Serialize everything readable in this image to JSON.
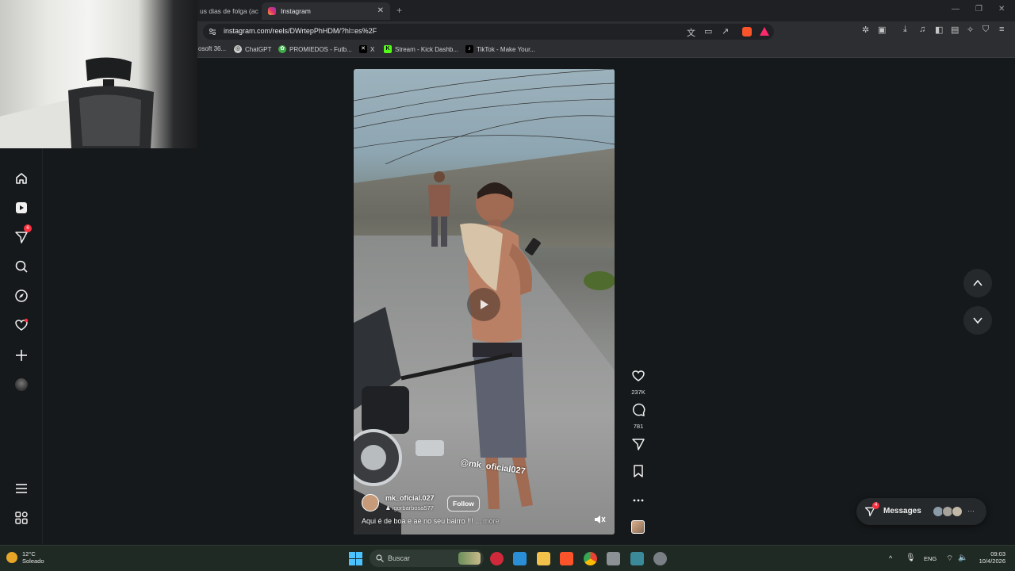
{
  "browser": {
    "tabs": [
      {
        "label": "us dias de folga (acc",
        "active": false
      },
      {
        "label": "Instagram",
        "active": true
      }
    ],
    "new_tab": "+",
    "url": "instagram.com/reels/DWrtepPhHDM/?hl=es%2F",
    "bookmarks": [
      {
        "label": "osoft 36...",
        "icon": "microsoft-icon"
      },
      {
        "label": "ChatGPT",
        "icon": "chatgpt-icon"
      },
      {
        "label": "PROMIEDOS - Futb...",
        "icon": "promiedos-icon"
      },
      {
        "label": "X",
        "icon": "x-icon"
      },
      {
        "label": "Stream - Kick Dashb...",
        "icon": "kick-icon"
      },
      {
        "label": "TikTok - Make Your...",
        "icon": "tiktok-icon"
      }
    ]
  },
  "sidebar": {
    "notifications_badge": "6"
  },
  "reel": {
    "author": "mk_oficial.027",
    "collaborator": "igorbarbosa577",
    "follow_label": "Follow",
    "caption": "Aqui é de boa e ae no seu bairro !!! ...",
    "more_label": "more",
    "watermark": "@mk_oficial027",
    "likes": "237K",
    "comments": "781"
  },
  "messages": {
    "label": "Messages",
    "badge": "4",
    "more": "···"
  },
  "taskbar": {
    "weather_temp": "12°C",
    "weather_desc": "Soleado",
    "search_label": "Buscar",
    "language": "ENG",
    "time": "09:03",
    "date": "10/4/2026"
  },
  "colors": {
    "accent_red": "#ff3040",
    "page_bg": "#16191b",
    "taskbar_bg": "#1f2a24"
  }
}
